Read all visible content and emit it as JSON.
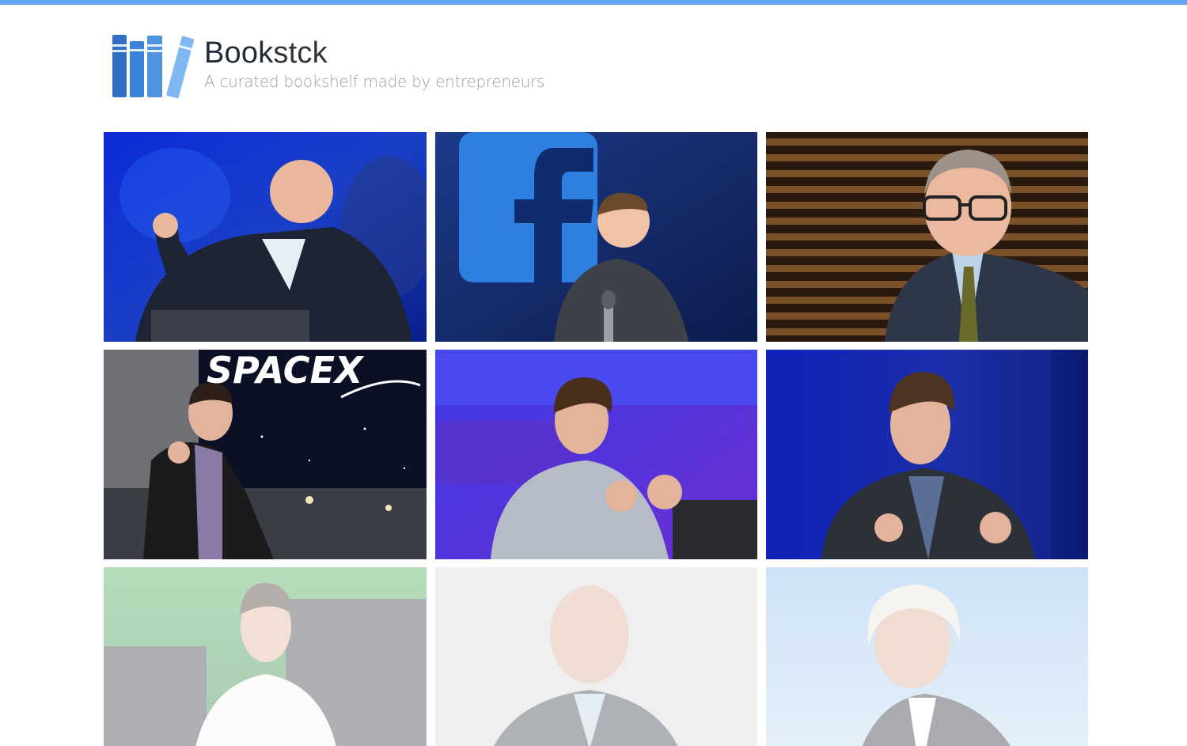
{
  "app": {
    "brand_bold": "Book",
    "brand_rest": "stck",
    "tagline": "A curated bookshelf made by entrepreneurs",
    "accent_color": "#5ea3ec",
    "logo_icon": "bookshelf-icon"
  },
  "grid": {
    "cards": [
      {
        "name": "card-1",
        "scene": "blue-stage",
        "faded": false
      },
      {
        "name": "card-2",
        "scene": "facebook-stage",
        "faded": false
      },
      {
        "name": "card-3",
        "scene": "wood-slats",
        "faded": false
      },
      {
        "name": "card-4",
        "scene": "spacex-stage",
        "faded": false,
        "sign_text": "SPACEX"
      },
      {
        "name": "card-5",
        "scene": "purple-stage",
        "faded": false
      },
      {
        "name": "card-6",
        "scene": "navy-stage",
        "faded": false
      },
      {
        "name": "card-7",
        "scene": "green-stage",
        "faded": true
      },
      {
        "name": "card-8",
        "scene": "grey-stage",
        "faded": true
      },
      {
        "name": "card-9",
        "scene": "sky-stage",
        "faded": true
      }
    ]
  }
}
